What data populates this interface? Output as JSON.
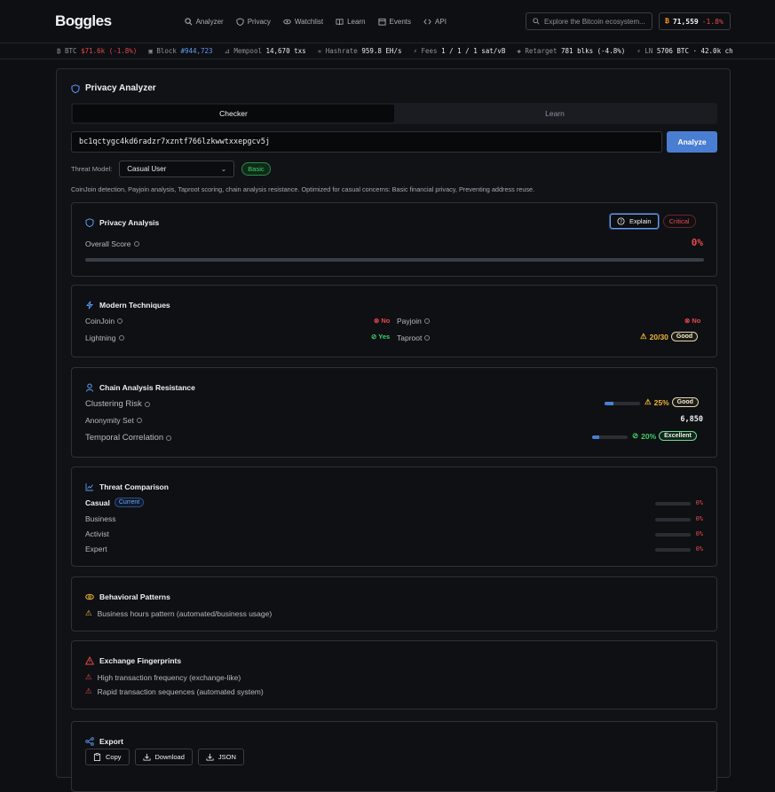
{
  "nav": {
    "logo": "Boggles",
    "links": [
      "Analyzer",
      "Privacy",
      "Watchlist",
      "Learn",
      "Events",
      "API"
    ],
    "search_placeholder": "Explore the Bitcoin ecosystem...",
    "price": "71,559",
    "price_change": "-1.8%"
  },
  "ticker": {
    "btc_label": "BTC",
    "btc_val": "$71.6k (-1.8%)",
    "block_label": "Block",
    "block_val": "#944,723",
    "mempool_label": "Mempool",
    "mempool_val": "14,670 txs",
    "hashrate_label": "Hashrate",
    "hashrate_val": "959.8 EH/s",
    "fees_label": "Fees",
    "fees_val": "1 / 1 / 1 sat/vB",
    "retarget_label": "Retarget",
    "retarget_val": "781 blks (-4.8%)",
    "ln_label": "LN",
    "ln_val": "5706 BTC · 42.0k ch"
  },
  "page": {
    "title": "Privacy Analyzer",
    "tabs": [
      "Checker",
      "Learn"
    ],
    "address": "bc1qctygc4kd6radzr7xzntf766lzkwwtxxepgcv5j",
    "analyze": "Analyze",
    "threat_label": "Threat Model:",
    "threat_value": "Casual User",
    "threat_level": "Basic",
    "description": "CoinJoin detection, Payjoin analysis, Taproot scoring, chain analysis resistance. Optimized for casual concerns: Basic financial privacy, Preventing address reuse."
  },
  "privacy": {
    "title": "Privacy Analysis",
    "explain": "Explain",
    "severity": "Critical",
    "score_label": "Overall Score",
    "score": "0%",
    "score_fill": 0
  },
  "modern": {
    "title": "Modern Techniques",
    "coinjoin_label": "CoinJoin",
    "coinjoin_val": "No",
    "payjoin_label": "Payjoin",
    "payjoin_val": "No",
    "lightning_label": "Lightning",
    "lightning_val": "Yes",
    "taproot_label": "Taproot",
    "taproot_val": "20/30",
    "taproot_badge": "Good"
  },
  "chain": {
    "title": "Chain Analysis Resistance",
    "clustering_label": "Clustering Risk",
    "clustering_val": "25%",
    "clustering_badge": "Good",
    "clustering_fill": 25,
    "anonymity_label": "Anonymity Set",
    "anonymity_val": "6,850",
    "temporal_label": "Temporal Correlation",
    "temporal_val": "20%",
    "temporal_badge": "Excellent",
    "temporal_fill": 20
  },
  "threat": {
    "title": "Threat Comparison",
    "current": "Current",
    "rows": [
      {
        "label": "Casual",
        "val": "0%"
      },
      {
        "label": "Business",
        "val": "0%"
      },
      {
        "label": "Activist",
        "val": "0%"
      },
      {
        "label": "Expert",
        "val": "0%"
      }
    ]
  },
  "behavior": {
    "title": "Behavioral Patterns",
    "items": [
      "Business hours pattern (automated/business usage)"
    ]
  },
  "exchange": {
    "title": "Exchange Fingerprints",
    "items": [
      "High transaction frequency (exchange-like)",
      "Rapid transaction sequences (automated system)"
    ]
  },
  "export": {
    "title": "Export",
    "copy": "Copy",
    "download": "Download",
    "json": "JSON"
  },
  "colors": {
    "accent": "#4a7ed2",
    "critical": "#e5484d",
    "good": "#3fcf6a",
    "warn": "#f0b33a"
  }
}
